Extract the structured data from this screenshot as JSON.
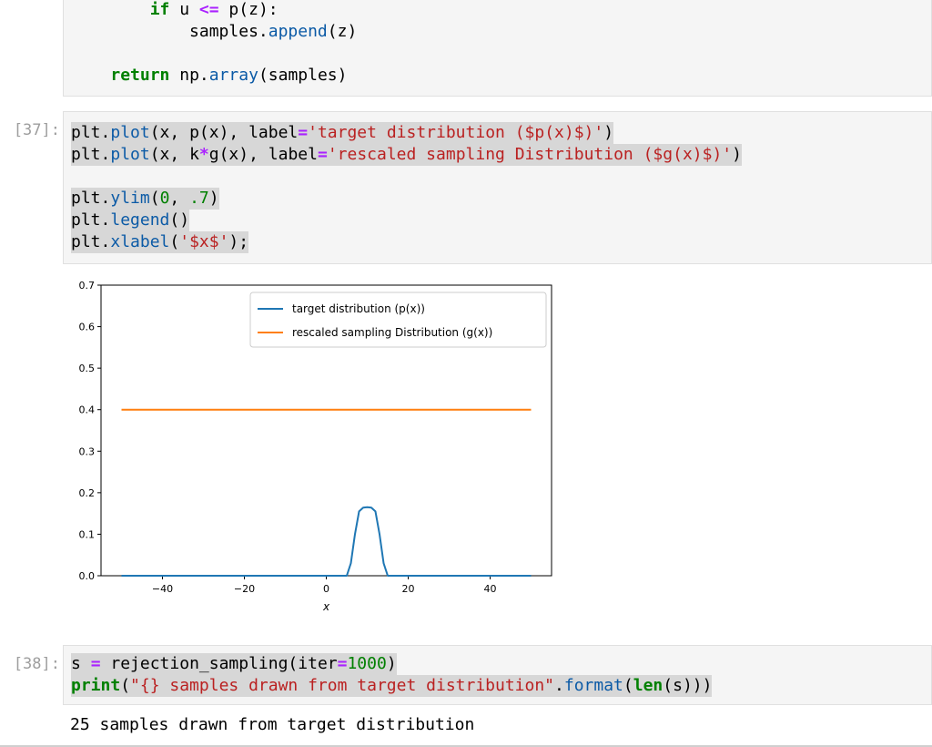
{
  "cells": [
    {
      "prompt": "",
      "lines": [
        [
          {
            "t": "        "
          },
          {
            "t": "if",
            "c": "kw"
          },
          {
            "t": " u "
          },
          {
            "t": "<=",
            "c": "op"
          },
          {
            "t": " p(z):"
          }
        ],
        [
          {
            "t": "            samples."
          },
          {
            "t": "append",
            "c": "fn"
          },
          {
            "t": "(z)"
          }
        ],
        [
          {
            "t": ""
          }
        ],
        [
          {
            "t": "    "
          },
          {
            "t": "return",
            "c": "kw"
          },
          {
            "t": " np."
          },
          {
            "t": "array",
            "c": "fn"
          },
          {
            "t": "(samples)"
          }
        ]
      ]
    },
    {
      "prompt": "[37]:",
      "lines": [
        [
          {
            "t": "plt."
          },
          {
            "t": "plot",
            "c": "fn"
          },
          {
            "t": "(x, p(x), label"
          },
          {
            "t": "=",
            "c": "op"
          },
          {
            "t": "'target distribution ($p(x)$)'",
            "c": "str"
          },
          {
            "t": ")"
          }
        ],
        [
          {
            "t": "plt."
          },
          {
            "t": "plot",
            "c": "fn"
          },
          {
            "t": "(x, k"
          },
          {
            "t": "*",
            "c": "op"
          },
          {
            "t": "g(x), label"
          },
          {
            "t": "=",
            "c": "op"
          },
          {
            "t": "'rescaled sampling Distribution ($g(x)$)'",
            "c": "str"
          },
          {
            "t": ")"
          }
        ],
        [
          {
            "t": ""
          }
        ],
        [
          {
            "t": "plt."
          },
          {
            "t": "ylim",
            "c": "fn"
          },
          {
            "t": "("
          },
          {
            "t": "0",
            "c": "num"
          },
          {
            "t": ", "
          },
          {
            "t": ".7",
            "c": "num"
          },
          {
            "t": ")"
          }
        ],
        [
          {
            "t": "plt."
          },
          {
            "t": "legend",
            "c": "fn"
          },
          {
            "t": "()"
          }
        ],
        [
          {
            "t": "plt."
          },
          {
            "t": "xlabel",
            "c": "fn"
          },
          {
            "t": "("
          },
          {
            "t": "'$x$'",
            "c": "str"
          },
          {
            "t": ");"
          }
        ]
      ]
    },
    {
      "prompt": "[38]:",
      "lines": [
        [
          {
            "t": "s "
          },
          {
            "t": "=",
            "c": "op"
          },
          {
            "t": " rejection_sampling(iter"
          },
          {
            "t": "=",
            "c": "op"
          },
          {
            "t": "1000",
            "c": "num"
          },
          {
            "t": ")"
          }
        ],
        [
          {
            "t": "print",
            "c": "kw"
          },
          {
            "t": "("
          },
          {
            "t": "\"{} samples drawn from target distribution\"",
            "c": "str"
          },
          {
            "t": "."
          },
          {
            "t": "format",
            "c": "fn"
          },
          {
            "t": "("
          },
          {
            "t": "len",
            "c": "kw"
          },
          {
            "t": "(s)))"
          }
        ]
      ]
    }
  ],
  "output": {
    "text": "25 samples drawn from target distribution"
  },
  "chart_data": {
    "type": "line",
    "xlim": [
      -55,
      55
    ],
    "ylim": [
      0,
      0.7
    ],
    "xlabel": "x",
    "x_ticks": [
      -40,
      -20,
      0,
      20,
      40
    ],
    "x_tick_labels": [
      "−40",
      "−20",
      "0",
      "20",
      "40"
    ],
    "y_ticks": [
      0.0,
      0.1,
      0.2,
      0.3,
      0.4,
      0.5,
      0.6,
      0.7
    ],
    "y_tick_labels": [
      "0.0",
      "0.1",
      "0.2",
      "0.3",
      "0.4",
      "0.5",
      "0.6",
      "0.7"
    ],
    "legend_position": "top-right",
    "series": [
      {
        "name": "target distribution (p(x))",
        "color": "#1f77b4",
        "x": [
          -50,
          -40,
          -30,
          -20,
          -10,
          0,
          5,
          6,
          7,
          8,
          9,
          10,
          11,
          12,
          13,
          14,
          15,
          20,
          30,
          40,
          50
        ],
        "y": [
          0.0,
          0.0,
          0.0,
          0.0,
          0.0,
          0.0,
          0.0,
          0.03,
          0.1,
          0.155,
          0.164,
          0.165,
          0.164,
          0.155,
          0.1,
          0.03,
          0.0,
          0.0,
          0.0,
          0.0,
          0.0
        ]
      },
      {
        "name": "rescaled sampling Distribution (g(x))",
        "color": "#ff7f0e",
        "x": [
          -50,
          50
        ],
        "y": [
          0.4,
          0.4
        ]
      }
    ]
  }
}
